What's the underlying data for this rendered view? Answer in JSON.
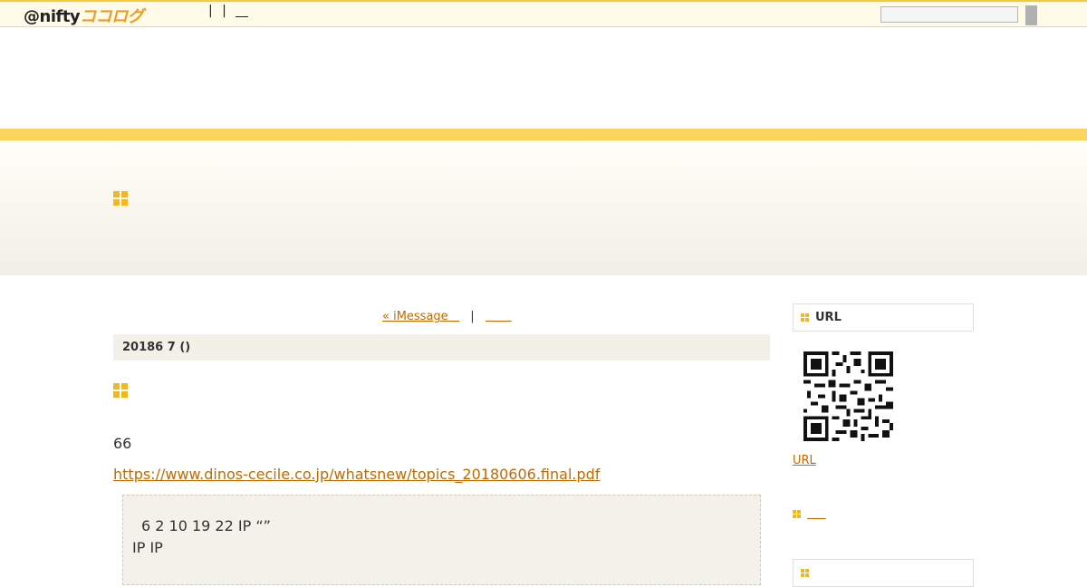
{
  "topbar": {
    "logo_prefix": "@nifty",
    "logo_brand": "ココログ",
    "nav_separator": "|",
    "search_placeholder": "",
    "search_button_label": ""
  },
  "pager": {
    "prev_label": "« iMessage",
    "separator": "|",
    "next_label": ""
  },
  "post": {
    "date": "20186 7 ()",
    "text": "66",
    "link": "https://www.dinos-cecile.co.jp/whatsnew/topics_20180606.final.pdf",
    "quote_line1": "6 2 10 19 22  IP “”",
    "quote_line2": "IP   IP"
  },
  "sidebar": {
    "url_heading": "URL",
    "url_link": "URL"
  },
  "colors": {
    "accent": "#fcd35b",
    "link": "#c06a00",
    "icon": "#f2b71c"
  }
}
